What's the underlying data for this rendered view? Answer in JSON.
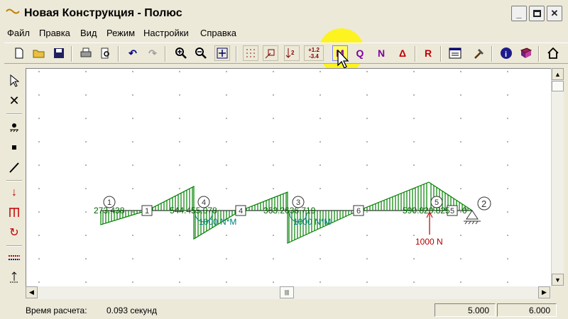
{
  "window": {
    "title": "Новая Конструкция - Полюс"
  },
  "menu": [
    "Файл",
    "Правка",
    "Вид",
    "Режим",
    "Настройки",
    "Справка"
  ],
  "toolbar": {
    "scale_label_top": "+1.2",
    "scale_label_bottom": "-3.4",
    "m_label": "M",
    "q_label": "Q",
    "n_label": "N",
    "delta_label": "Δ",
    "r_label": "R"
  },
  "colors": {
    "diagram": "#008000",
    "moment_text": "#008080",
    "force": "#b00000",
    "accent": "#ffff00"
  },
  "diagram": {
    "node_labels": [
      "1",
      "2",
      "3",
      "4",
      "5",
      "6"
    ],
    "element_labels": [
      "1",
      "3",
      "4",
      "6",
      "5"
    ],
    "values": [
      "273.438",
      "544.455.078",
      "363.2636.719",
      "590.820.825",
      "0"
    ],
    "moment_labels": [
      "1000 N*M",
      "1000 N*M"
    ],
    "force_label": "1000 N"
  },
  "status": {
    "label": "Время расчета:",
    "time": "0.093 секунд",
    "x": "5.000",
    "y": "6.000"
  }
}
